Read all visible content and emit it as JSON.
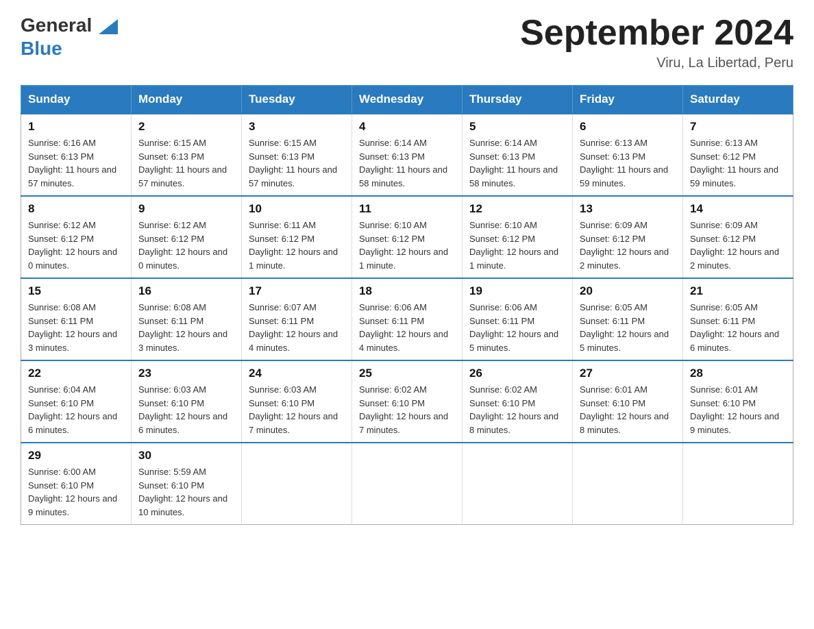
{
  "header": {
    "logo_general": "General",
    "logo_blue": "Blue",
    "month_title": "September 2024",
    "location": "Viru, La Libertad, Peru"
  },
  "days_of_week": [
    "Sunday",
    "Monday",
    "Tuesday",
    "Wednesday",
    "Thursday",
    "Friday",
    "Saturday"
  ],
  "weeks": [
    [
      {
        "day": "1",
        "sunrise": "6:16 AM",
        "sunset": "6:13 PM",
        "daylight": "11 hours and 57 minutes."
      },
      {
        "day": "2",
        "sunrise": "6:15 AM",
        "sunset": "6:13 PM",
        "daylight": "11 hours and 57 minutes."
      },
      {
        "day": "3",
        "sunrise": "6:15 AM",
        "sunset": "6:13 PM",
        "daylight": "11 hours and 57 minutes."
      },
      {
        "day": "4",
        "sunrise": "6:14 AM",
        "sunset": "6:13 PM",
        "daylight": "11 hours and 58 minutes."
      },
      {
        "day": "5",
        "sunrise": "6:14 AM",
        "sunset": "6:13 PM",
        "daylight": "11 hours and 58 minutes."
      },
      {
        "day": "6",
        "sunrise": "6:13 AM",
        "sunset": "6:13 PM",
        "daylight": "11 hours and 59 minutes."
      },
      {
        "day": "7",
        "sunrise": "6:13 AM",
        "sunset": "6:12 PM",
        "daylight": "11 hours and 59 minutes."
      }
    ],
    [
      {
        "day": "8",
        "sunrise": "6:12 AM",
        "sunset": "6:12 PM",
        "daylight": "12 hours and 0 minutes."
      },
      {
        "day": "9",
        "sunrise": "6:12 AM",
        "sunset": "6:12 PM",
        "daylight": "12 hours and 0 minutes."
      },
      {
        "day": "10",
        "sunrise": "6:11 AM",
        "sunset": "6:12 PM",
        "daylight": "12 hours and 1 minute."
      },
      {
        "day": "11",
        "sunrise": "6:10 AM",
        "sunset": "6:12 PM",
        "daylight": "12 hours and 1 minute."
      },
      {
        "day": "12",
        "sunrise": "6:10 AM",
        "sunset": "6:12 PM",
        "daylight": "12 hours and 1 minute."
      },
      {
        "day": "13",
        "sunrise": "6:09 AM",
        "sunset": "6:12 PM",
        "daylight": "12 hours and 2 minutes."
      },
      {
        "day": "14",
        "sunrise": "6:09 AM",
        "sunset": "6:12 PM",
        "daylight": "12 hours and 2 minutes."
      }
    ],
    [
      {
        "day": "15",
        "sunrise": "6:08 AM",
        "sunset": "6:11 PM",
        "daylight": "12 hours and 3 minutes."
      },
      {
        "day": "16",
        "sunrise": "6:08 AM",
        "sunset": "6:11 PM",
        "daylight": "12 hours and 3 minutes."
      },
      {
        "day": "17",
        "sunrise": "6:07 AM",
        "sunset": "6:11 PM",
        "daylight": "12 hours and 4 minutes."
      },
      {
        "day": "18",
        "sunrise": "6:06 AM",
        "sunset": "6:11 PM",
        "daylight": "12 hours and 4 minutes."
      },
      {
        "day": "19",
        "sunrise": "6:06 AM",
        "sunset": "6:11 PM",
        "daylight": "12 hours and 5 minutes."
      },
      {
        "day": "20",
        "sunrise": "6:05 AM",
        "sunset": "6:11 PM",
        "daylight": "12 hours and 5 minutes."
      },
      {
        "day": "21",
        "sunrise": "6:05 AM",
        "sunset": "6:11 PM",
        "daylight": "12 hours and 6 minutes."
      }
    ],
    [
      {
        "day": "22",
        "sunrise": "6:04 AM",
        "sunset": "6:10 PM",
        "daylight": "12 hours and 6 minutes."
      },
      {
        "day": "23",
        "sunrise": "6:03 AM",
        "sunset": "6:10 PM",
        "daylight": "12 hours and 6 minutes."
      },
      {
        "day": "24",
        "sunrise": "6:03 AM",
        "sunset": "6:10 PM",
        "daylight": "12 hours and 7 minutes."
      },
      {
        "day": "25",
        "sunrise": "6:02 AM",
        "sunset": "6:10 PM",
        "daylight": "12 hours and 7 minutes."
      },
      {
        "day": "26",
        "sunrise": "6:02 AM",
        "sunset": "6:10 PM",
        "daylight": "12 hours and 8 minutes."
      },
      {
        "day": "27",
        "sunrise": "6:01 AM",
        "sunset": "6:10 PM",
        "daylight": "12 hours and 8 minutes."
      },
      {
        "day": "28",
        "sunrise": "6:01 AM",
        "sunset": "6:10 PM",
        "daylight": "12 hours and 9 minutes."
      }
    ],
    [
      {
        "day": "29",
        "sunrise": "6:00 AM",
        "sunset": "6:10 PM",
        "daylight": "12 hours and 9 minutes."
      },
      {
        "day": "30",
        "sunrise": "5:59 AM",
        "sunset": "6:10 PM",
        "daylight": "12 hours and 10 minutes."
      },
      null,
      null,
      null,
      null,
      null
    ]
  ],
  "labels": {
    "sunrise": "Sunrise:",
    "sunset": "Sunset:",
    "daylight": "Daylight:"
  }
}
